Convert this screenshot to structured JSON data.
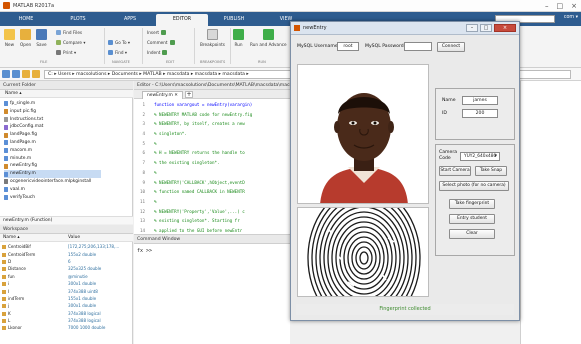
{
  "window": {
    "title": "MATLAB R2017a"
  },
  "tabs": [
    "HOME",
    "PLOTS",
    "APPS",
    "EDITOR",
    "PUBLISH",
    "VIEW"
  ],
  "active_tab": "EDITOR",
  "user_label": "com ▾",
  "ribbon": {
    "new": "New",
    "open": "Open",
    "save": "Save",
    "find_files": "Find Files",
    "compare": "Compare ▾",
    "print": "Print ▾",
    "insert": "Insert",
    "comment": "Comment",
    "indent": "Indent",
    "goto": "Go To ▾",
    "find": "Find ▾",
    "breakpoints": "Breakpoints",
    "run": "Run",
    "run_and_advance": "Run and Advance",
    "sections": [
      "FILE",
      "NAVIGATE",
      "EDIT",
      "BREAKPOINTS",
      "RUN"
    ]
  },
  "address_path": "C: ▸ Users ▸ macsolutions ▸ Documents ▸ MATLAB ▸ macsdata ▸ macsdata ▸ macsdata ▸",
  "current_folder": {
    "title": "Current Folder",
    "column": "Name ▴",
    "files": [
      "fp_single.m",
      "input pic.fig",
      "Instructions.txt",
      "jdbcConfig.mat",
      "landPage.fig",
      "landPage.m",
      "macom.m",
      "minute.m",
      "newEntry.fig",
      "newEntry.m",
      "ocgenericvideointerface.mlpkginstall",
      "vaal.m",
      "verifyTouch"
    ],
    "selected_index": 9,
    "details": "newEntry.m (Function)"
  },
  "workspace": {
    "title": "Workspace",
    "headers": [
      "Name ▴",
      "Value"
    ],
    "rows": [
      [
        "CentroidBif",
        "[172,275;206,133;178,..."
      ],
      [
        "CentroidTerm",
        "155x2 double"
      ],
      [
        "D",
        "6"
      ],
      [
        "Distance",
        "325x325 double"
      ],
      [
        "fun",
        "@minutie"
      ],
      [
        "i",
        "300x1 double"
      ],
      [
        "I",
        "374x388 uint8"
      ],
      [
        "indTerm",
        "155x1 double"
      ],
      [
        "j",
        "300x1 double"
      ],
      [
        "K",
        "374x388 logical"
      ],
      [
        "L",
        "374x388 logical"
      ],
      [
        "Lkonor",
        "7000 1000 double"
      ]
    ]
  },
  "editor": {
    "title": "Editor - C:\\Users\\macsolutions\\Documents\\MATLAB\\macsdata\\macs",
    "tab": "newEntry.m ✕",
    "lines": [
      [
        "1",
        "function varargout = newEntry(varargin)"
      ],
      [
        "2",
        "% NEWENTRY MATLAB code for newEntry.fig"
      ],
      [
        "3",
        "%      NEWENTRY, by itself, creates a new"
      ],
      [
        "4",
        "%      singleton*."
      ],
      [
        "5",
        "%"
      ],
      [
        "6",
        "%      H = NEWENTRY returns the handle to"
      ],
      [
        "7",
        "%      the existing singleton*."
      ],
      [
        "8",
        "%"
      ],
      [
        "9",
        "%      NEWENTRY('CALLBACK',hObject,eventD"
      ],
      [
        "10",
        "%      function named CALLBACK in NEWENTR"
      ],
      [
        "11",
        "%"
      ],
      [
        "12",
        "%      NEWENTRY('Property','Value',...) c"
      ],
      [
        "13",
        "%      existing singleton*.  Starting fr"
      ],
      [
        "14",
        "%      applied to the GUI before newEntr"
      ]
    ]
  },
  "command_window": {
    "title": "Command Window",
    "prompt": "fx >>"
  },
  "gui": {
    "title": "newEntry",
    "mysql_username_label": "MySQL Username",
    "mysql_username_value": "root",
    "mysql_password_label": "MySQL Password",
    "mysql_password_value": "",
    "connect_button": "Connect",
    "name_label": "Name",
    "name_value": "james",
    "id_label": "ID",
    "id_value": "200",
    "camera_code_label": "Camera Code",
    "camera_code_value": "YUY2_640x480",
    "start_camera": "Start Camera",
    "take_snap": "Take Snap",
    "select_photo": "Select photo (for no camera)",
    "take_fingerprint": "Take fingerprint",
    "entry_student": "Entry student",
    "clear": "Clear",
    "status": "Fingerprint collected"
  }
}
